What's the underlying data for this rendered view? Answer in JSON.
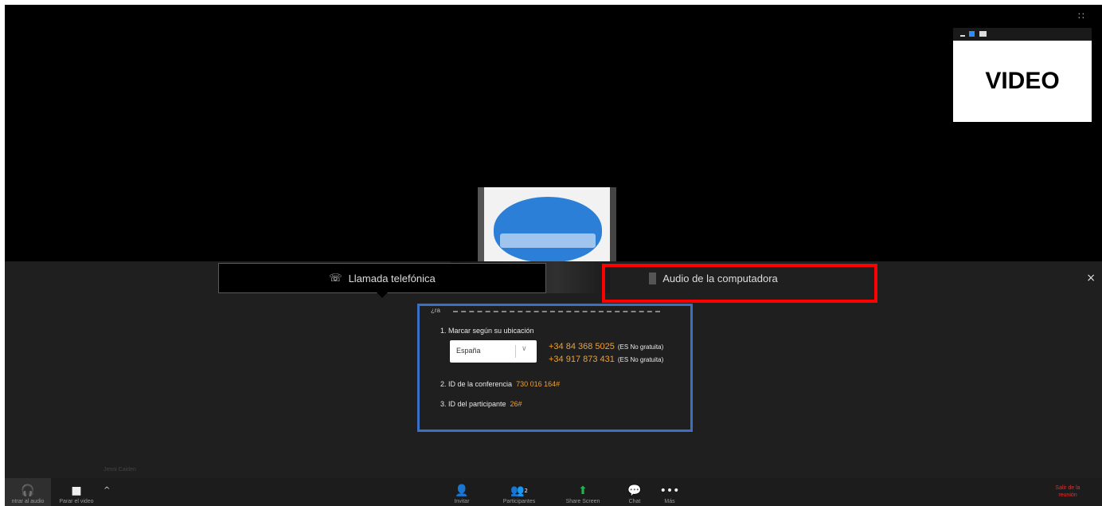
{
  "window": {
    "grid_icon": "grid-icon",
    "grid_glyph": "∷"
  },
  "thumbnail": {
    "label": "VIDEO",
    "controls": [
      "minimize-icon",
      "restore-icon",
      "maximize-icon"
    ]
  },
  "audio_panel": {
    "tab_phone": {
      "icon": "phone-icon",
      "glyph": "☏",
      "label": "Llamada telefónica"
    },
    "tab_computer": {
      "icon": "computer-icon",
      "label": "Audio de la computadora"
    },
    "close_glyph": "×",
    "dial": {
      "header_fragment": "¿ra",
      "step1_label": "1. Marcar según su ubicación",
      "country_select": {
        "value": "España",
        "chevron": "∨"
      },
      "numbers": [
        {
          "number": "+34 84 368 5025",
          "note": "(ES No gratuita)"
        },
        {
          "number": "+34 917 873 431",
          "note": "(ES No gratuita)"
        }
      ],
      "step2_label": "2. ID de la conferencia",
      "conference_id": "730 016 164#",
      "step3_label": "3. ID del participante",
      "participant_id": "26#"
    },
    "speaker_name": "Jenni Caiden"
  },
  "toolbar": {
    "audio_label": "ntrar al audio",
    "audio_glyph": "🎧",
    "video_label": "Parar el video",
    "video_glyph": "■",
    "caret_glyph": "^",
    "invite_label": "Invitar",
    "invite_glyph": "👤",
    "participants_label": "Participantes",
    "participants_glyph": "👥",
    "participants_count": "2",
    "share_label": "Share Screen",
    "share_glyph": "⬆",
    "chat_label": "Chat",
    "chat_glyph": "💬",
    "more_label": "Más",
    "more_glyph": "•••",
    "leave_label": "Salir de la reunión"
  },
  "colors": {
    "accent_blue": "#2d8cff",
    "share_green": "#23b24b",
    "number_orange": "#f0a030",
    "leave_red": "#e03030",
    "highlight_red": "#ff0000",
    "highlight_blue": "#3b6fc5"
  }
}
